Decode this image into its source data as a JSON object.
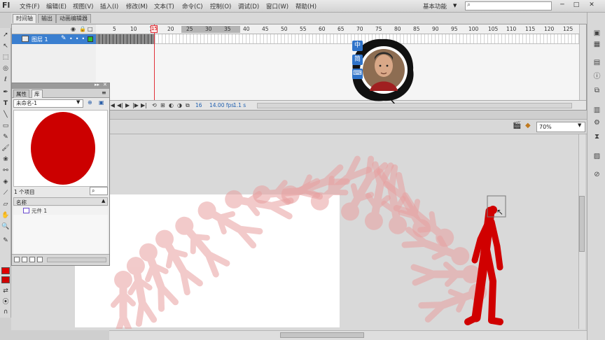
{
  "app": {
    "logo": "Fl"
  },
  "menubar": {
    "items": [
      "文件(F)",
      "编辑(E)",
      "视图(V)",
      "插入(I)",
      "修改(M)",
      "文本(T)",
      "命令(C)",
      "控制(O)",
      "调试(D)",
      "窗口(W)",
      "帮助(H)"
    ],
    "workspace_label": "基本功能",
    "search_placeholder": ""
  },
  "window_controls": {
    "minimize": "─",
    "maximize": "□",
    "close": "✕"
  },
  "timeline": {
    "tabs": [
      "时间轴",
      "输出",
      "动画编辑器"
    ],
    "ruler_numbers": [
      "5",
      "10",
      "15",
      "20",
      "25",
      "30",
      "35",
      "40",
      "45",
      "50",
      "55",
      "60",
      "65",
      "70",
      "75",
      "80",
      "85",
      "90",
      "95",
      "100",
      "105",
      "110",
      "115",
      "120",
      "125"
    ],
    "playhead_frame": "15",
    "layer_name": "图层 1",
    "current_frame": "16",
    "fps": "14.00 fps",
    "time": "1.1 s"
  },
  "ime": {
    "keys": [
      "中",
      "简",
      "⌨"
    ]
  },
  "library": {
    "tabs": [
      "属性",
      "库"
    ],
    "document": "未命名-1",
    "item_count": "1 个项目",
    "column_name": "名称",
    "items": [
      {
        "name": "元件 1"
      }
    ]
  },
  "stage": {
    "zoom": "70%",
    "colors": {
      "figure_red": "#d00000",
      "onion_red": "#e8a0a0",
      "preview_circle": "#cc0000"
    }
  },
  "icons": {
    "toolbar": [
      "selection-icon",
      "subselection-icon",
      "free-transform-icon",
      "3d-rotation-icon",
      "lasso-icon",
      "pen-icon",
      "text-icon",
      "line-icon",
      "rectangle-icon",
      "pencil-icon",
      "brush-icon",
      "deco-icon",
      "bone-icon",
      "paint-bucket-icon",
      "eyedropper-icon",
      "eraser-icon",
      "hand-icon",
      "zoom-icon"
    ]
  }
}
